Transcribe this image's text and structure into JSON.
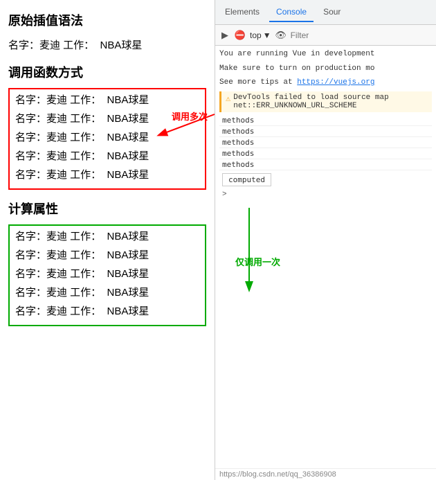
{
  "left": {
    "section1_title": "原始插值语法",
    "section1_row": "名字：麦迪 工作：  NBA球星",
    "section2_title": "调用函数方式",
    "section2_rows": [
      "名字：麦迪 工作：  NBA球星",
      "名字：麦迪 工作：  NBA球星",
      "名字：麦迪 工作：  NBA球星",
      "名字：麦迪 工作：  NBA球星",
      "名字：麦迪 工作：  NBA球星"
    ],
    "section3_title": "计算属性",
    "section3_rows": [
      "名字：麦迪 工作：  NBA球星",
      "名字：麦迪 工作：  NBA球星",
      "名字：麦迪 工作：  NBA球星",
      "名字：麦迪 工作：  NBA球星",
      "名字：麦迪 工作：  NBA球星"
    ]
  },
  "annotations": {
    "red_label": "调用多次",
    "green_label": "仅调用一次"
  },
  "devtools": {
    "tabs": [
      "Elements",
      "Console",
      "Sour"
    ],
    "active_tab": "Console",
    "toolbar": {
      "top_label": "top",
      "filter_placeholder": "Filter"
    },
    "console_lines": [
      "You are running Vue in development",
      "Make sure to turn on production mo",
      "See more tips at https://vuejs.org"
    ],
    "warning_text": "DevTools failed to load source map",
    "warning_detail": "net::ERR_UNKNOWN_URL_SCHEME",
    "log_entries": [
      "methods",
      "methods",
      "methods",
      "methods",
      "methods"
    ],
    "computed_label": "computed",
    "arrow_label": ">"
  },
  "footer": {
    "link": "https://blog.csdn.net/qq_36386908"
  }
}
